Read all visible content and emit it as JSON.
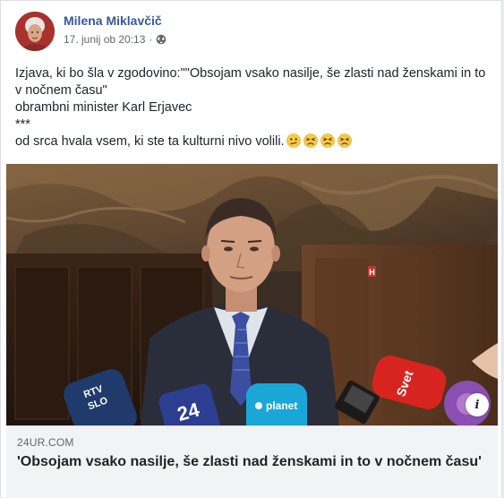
{
  "post": {
    "author_name": "Milena Miklavčič",
    "timestamp": "17. junij ob 20:13",
    "separator": "·",
    "privacy_icon": "globe-icon",
    "text_lines": [
      "Izjava, ki bo šla v zgodovino:\"\"Obsojam vsako nasilje, še zlasti nad ženskami in to v nočnem času\"",
      "obrambni minister Karl Erjavec",
      "***",
      "od srca hvala vsem, ki ste ta kulturni nivo volili."
    ],
    "emojis": [
      "confused-face-icon",
      "persevering-face-icon",
      "persevering-face-icon",
      "persevering-face-icon"
    ]
  },
  "link_preview": {
    "domain": "24UR.COM",
    "title": "'Obsojam vsako nasilje, še zlasti nad ženskami in to v nočnem času'",
    "info_label": "i",
    "mic_labels": {
      "rtv": "RTV SLO",
      "planet": "planet",
      "svet": "Svet",
      "ch24": "24"
    }
  },
  "colors": {
    "author": "#385898",
    "meta": "#616770",
    "text": "#1d2129",
    "link_box": "#f2f3f5"
  }
}
